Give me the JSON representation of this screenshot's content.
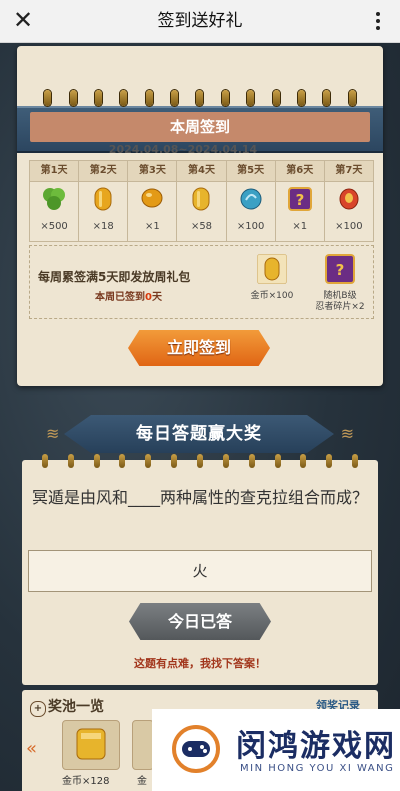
{
  "topbar": {
    "title": "签到送好礼",
    "close_icon": "close-icon",
    "more_icon": "more-dots-icon"
  },
  "weekly_card": {
    "banner": "每周签到送好礼",
    "subheader": "本周签到",
    "date_range": "2024.04.08~2024.04.14",
    "days": [
      {
        "label": "第1天",
        "amount": "×500",
        "icon": "green-gem-icon",
        "color": "#5da832"
      },
      {
        "label": "第2天",
        "amount": "×18",
        "icon": "gold-coin-stack-icon",
        "color": "#e7a61e"
      },
      {
        "label": "第3天",
        "amount": "×1",
        "icon": "gold-bean-icon",
        "color": "#e39a16"
      },
      {
        "label": "第4天",
        "amount": "×58",
        "icon": "gold-coin-stack-icon",
        "color": "#e7b42c"
      },
      {
        "label": "第5天",
        "amount": "×100",
        "icon": "blue-orb-icon",
        "color": "#3aa0c4"
      },
      {
        "label": "第6天",
        "amount": "×1",
        "icon": "mystery-box-icon",
        "color": "#6b2d84"
      },
      {
        "label": "第7天",
        "amount": "×100",
        "icon": "red-token-icon",
        "color": "#d8452a"
      }
    ],
    "weekly_bonus": {
      "title": "每周累签满5天即发放周礼包",
      "progress_prefix": "本周已签到",
      "progress_count": "0",
      "progress_suffix": "天",
      "items": [
        {
          "caption": "金币×100",
          "icon": "gold-coin-stack-icon"
        },
        {
          "caption_line1": "随机B级",
          "caption_line2": "忍者碎片×2",
          "icon": "mystery-box-icon"
        }
      ]
    },
    "sign_button": "立即签到"
  },
  "quiz": {
    "banner": "每日答题赢大奖",
    "question": "冥遁是由风和____两种属性的查克拉组合而成？",
    "answer": "火",
    "done_button": "今日已答",
    "hint": "这题有点难，我找下答案！"
  },
  "prize_pool": {
    "title": "奖池一览",
    "record_link": "领奖记录",
    "prizes": [
      {
        "caption": "金币×128",
        "icon": "gold-coin-stack-icon"
      },
      {
        "caption": "金",
        "icon": "gold-coin-stack-icon"
      }
    ]
  },
  "watermark": {
    "name": "闵鸿游戏网",
    "latin": "MIN HONG YOU XI WANG"
  }
}
